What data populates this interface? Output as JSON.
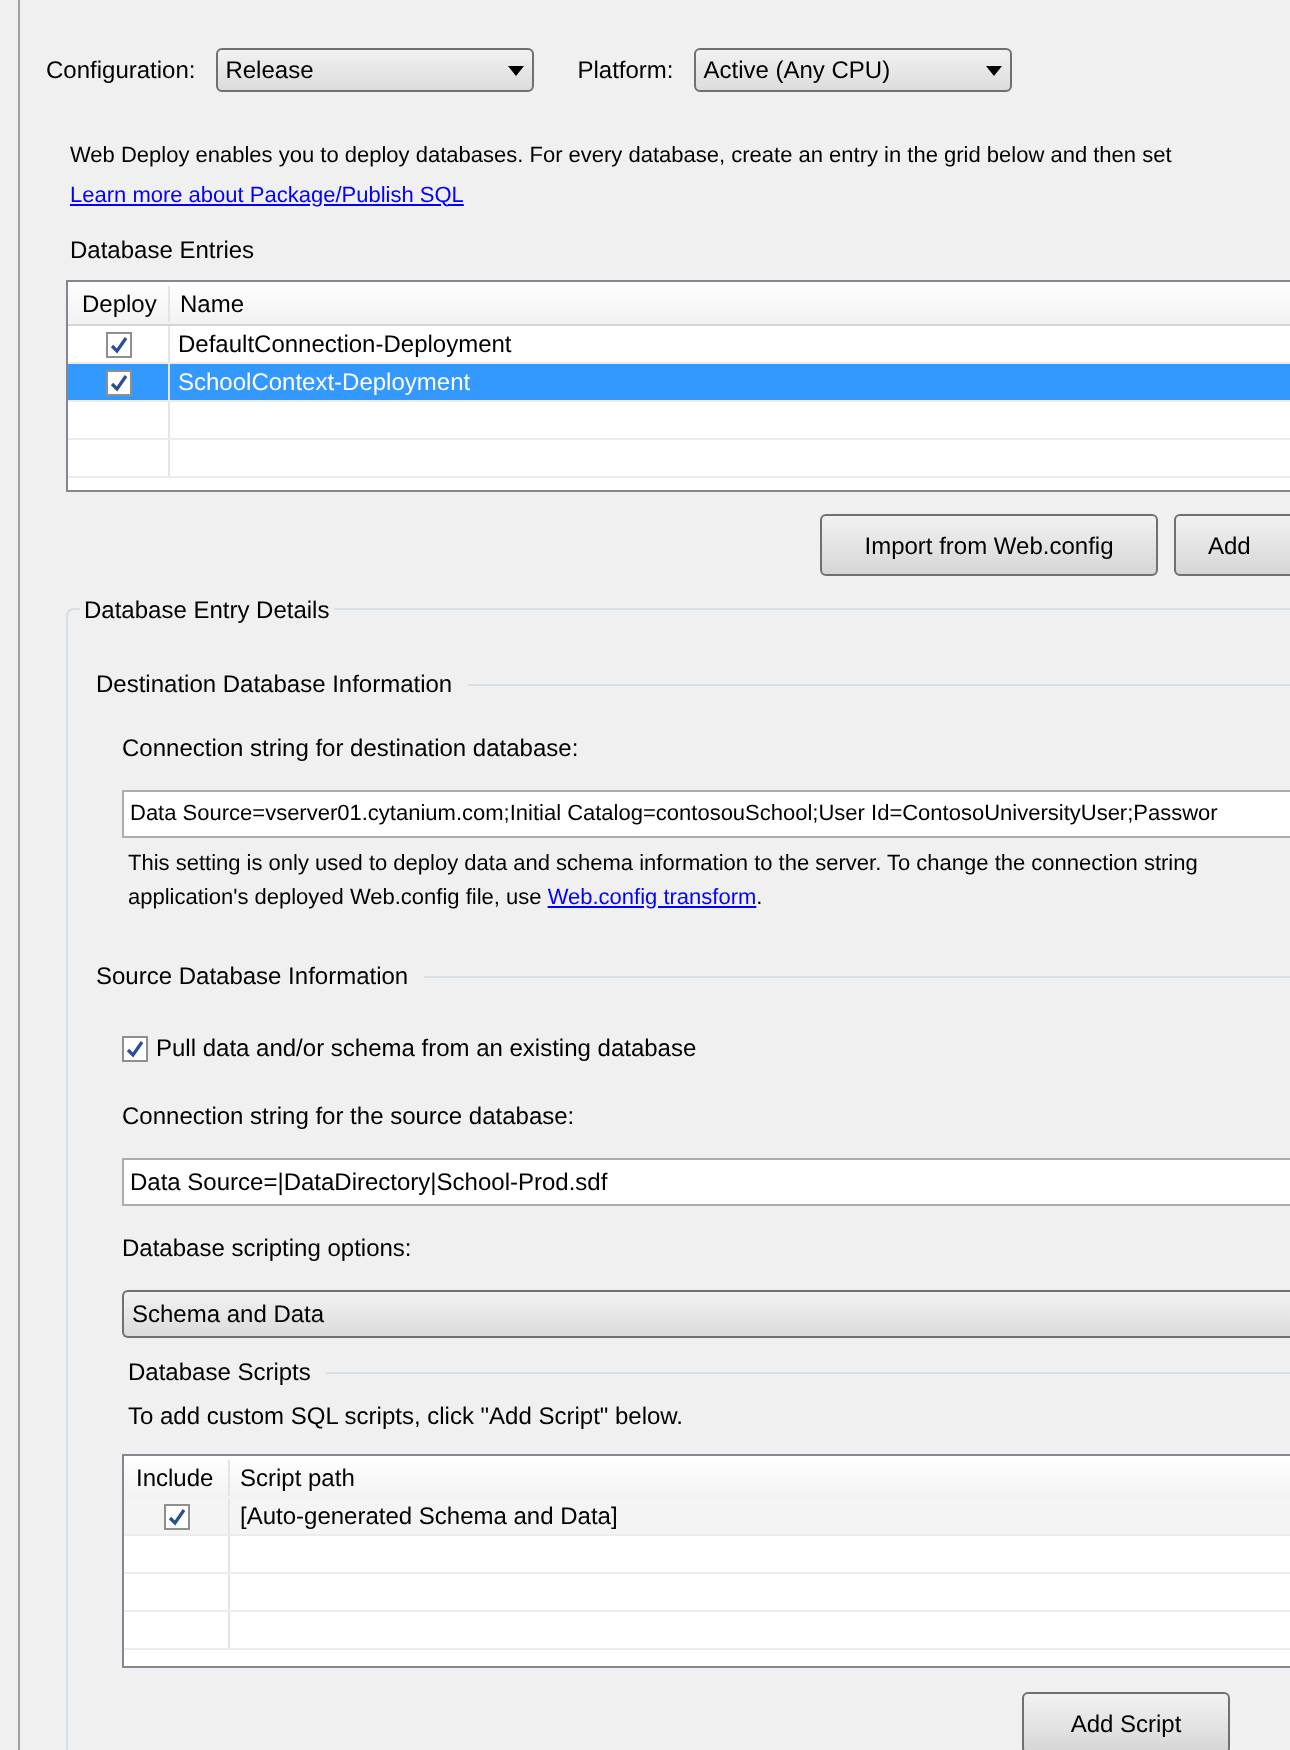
{
  "toolbar": {
    "configuration": {
      "label": "Configuration:",
      "value": "Release"
    },
    "platform": {
      "label": "Platform:",
      "value": "Active (Any CPU)"
    }
  },
  "intro": {
    "text": "Web Deploy enables you to deploy databases. For every database, create an entry in the grid below and then set",
    "link": "Learn more about Package/Publish SQL"
  },
  "database_entries": {
    "title": "Database Entries",
    "columns": [
      "Deploy",
      "Name"
    ],
    "rows": [
      {
        "name": "DefaultConnection-Deployment",
        "deploy": true,
        "selected": false
      },
      {
        "name": "SchoolContext-Deployment",
        "deploy": true,
        "selected": true
      }
    ],
    "buttons": [
      "Import from Web.config",
      "Add"
    ]
  },
  "details": {
    "title": "Database Entry Details",
    "destination": {
      "title": "Destination Database Information",
      "label": "Connection string for destination database:",
      "value": "Data Source=vserver01.cytanium.com;Initial Catalog=contosouSchool;User Id=ContosoUniversityUser;Passwor",
      "note": "This setting is only used to deploy data and schema information to the server. To change the connection string",
      "note2": "application's deployed Web.config file, use",
      "note_link": "Web.config transform",
      "note_end": "."
    },
    "source": {
      "title": "Source Database Information",
      "pull": {
        "label": "Pull data and/or schema from an existing database",
        "checked": true
      },
      "label": "Connection string for the source database:",
      "value": "Data Source=|DataDirectory|School-Prod.sdf",
      "options_label": "Database scripting options:",
      "option": "Schema and Data"
    },
    "scripts": {
      "title": "Database Scripts",
      "hint": "To add custom SQL scripts, click \"Add Script\" below.",
      "columns": [
        "Include",
        "Script path"
      ],
      "rows": [
        {
          "path": "[Auto-generated Schema and Data]",
          "include": true
        }
      ],
      "button": "Add Script"
    }
  }
}
